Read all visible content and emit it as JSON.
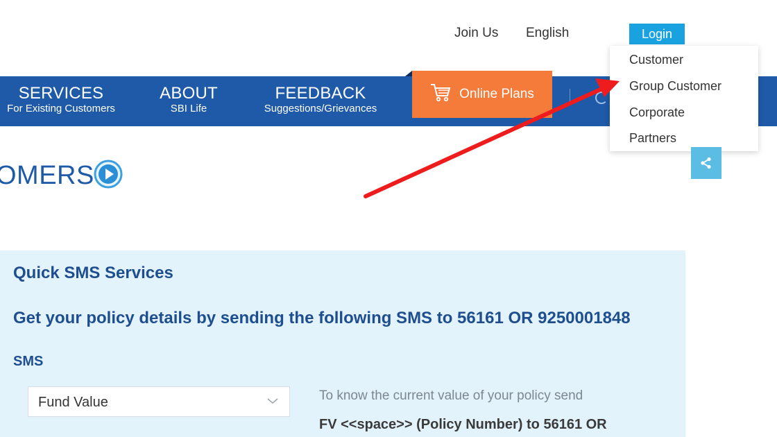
{
  "header": {
    "join_us": "Join Us",
    "language": "English",
    "login": "Login"
  },
  "login_menu": {
    "items": [
      "Customer",
      "Group Customer",
      "Corporate",
      "Partners"
    ]
  },
  "nav": {
    "services": {
      "title": "SERVICES",
      "subtitle": "For Existing Customers"
    },
    "about": {
      "title": "ABOUT",
      "subtitle": "SBI Life"
    },
    "feedback": {
      "title": "FEEDBACK",
      "subtitle": "Suggestions/Grievances"
    },
    "online_plans": "Online Plans"
  },
  "page": {
    "heading": "OMERS"
  },
  "sms_panel": {
    "title": "Quick SMS Services",
    "subtitle": "Get your policy details by sending the following SMS to 56161 OR 9250001848",
    "label": "SMS",
    "selected_option": "Fund Value",
    "description": "To know the current value of your policy send",
    "code": "FV <<space>> (Policy Number) to 56161 OR"
  },
  "colors": {
    "nav_blue": "#1e5aa8",
    "login_blue": "#1aa2e0",
    "online_orange": "#f47b3a",
    "panel_bg": "#e3f3fb",
    "arrow_red": "#ee1c1c"
  },
  "icons": [
    "cart-icon",
    "share-icon",
    "play-circle-icon",
    "chevron-down-icon",
    "search-icon"
  ]
}
